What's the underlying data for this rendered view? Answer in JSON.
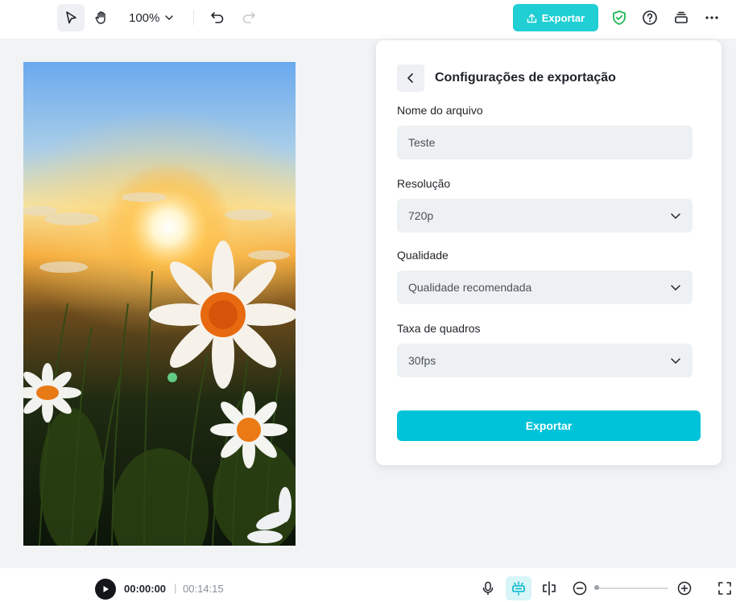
{
  "toolbar": {
    "zoom_level": "100%",
    "export_label": "Exportar"
  },
  "export_panel": {
    "title": "Configurações de exportação",
    "filename": {
      "label": "Nome do arquivo",
      "value": "Teste"
    },
    "resolution": {
      "label": "Resolução",
      "value": "720p"
    },
    "quality": {
      "label": "Qualidade",
      "value": "Qualidade recomendada"
    },
    "framerate": {
      "label": "Taxa de quadros",
      "value": "30fps"
    },
    "export_button": "Exportar"
  },
  "playback": {
    "current_time": "00:00:00",
    "separator": "|",
    "total_time": "00:14:15"
  },
  "colors": {
    "accent": "#00c3d9",
    "export_top": "#1fcfd3",
    "shield_green": "#1db954"
  },
  "icons": [
    "pointer-icon",
    "hand-icon",
    "chevron-down-icon",
    "undo-icon",
    "redo-icon",
    "upload-icon",
    "shield-icon",
    "help-icon",
    "layers-icon",
    "more-icon",
    "back-icon",
    "play-icon",
    "microphone-icon",
    "auto-snap-icon",
    "split-icon",
    "zoom-out-icon",
    "zoom-in-icon",
    "fullscreen-icon"
  ]
}
